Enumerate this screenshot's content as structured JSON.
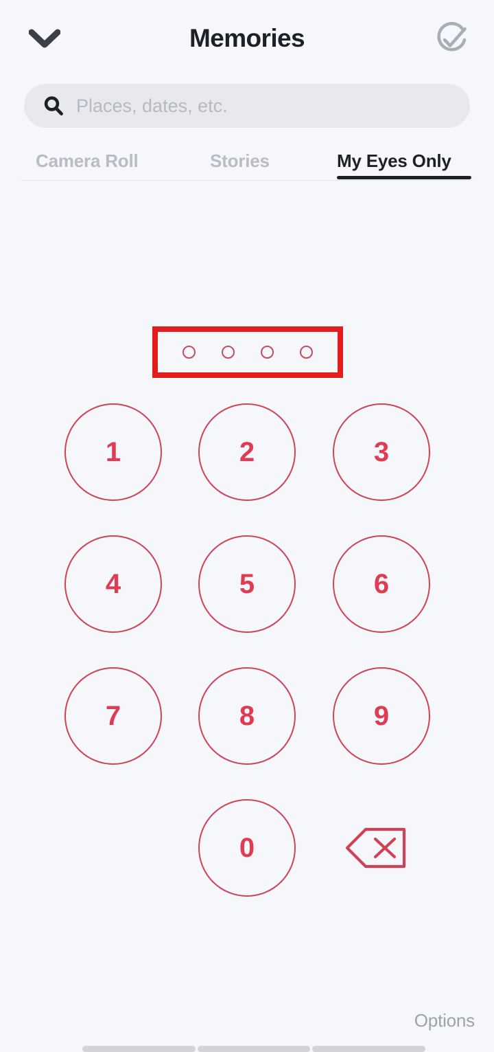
{
  "app": {
    "background_color": "#f6f7fa",
    "accent_color": "#e03b53",
    "annotation_color": "#e11d1d"
  },
  "header": {
    "title": "Memories",
    "back_icon": "chevron-down-icon",
    "confirm_icon": "check-circle-icon"
  },
  "search": {
    "icon": "search-icon",
    "value": "",
    "placeholder": "Places, dates, etc."
  },
  "tabs": {
    "items": [
      {
        "label": "Camera Roll",
        "active": false
      },
      {
        "label": "Stories",
        "active": false
      },
      {
        "label": "My Eyes Only",
        "active": true
      }
    ]
  },
  "passcode": {
    "dot_count": 4,
    "entered_count": 0,
    "dots": [
      "",
      "",
      "",
      ""
    ],
    "annotated": true,
    "annotation_label": "passcode-dots-highlight"
  },
  "keypad": {
    "keys": [
      {
        "label": "1"
      },
      {
        "label": "2"
      },
      {
        "label": "3"
      },
      {
        "label": "4"
      },
      {
        "label": "5"
      },
      {
        "label": "6"
      },
      {
        "label": "7"
      },
      {
        "label": "8"
      },
      {
        "label": "9"
      },
      {
        "label": "0"
      }
    ],
    "backspace_icon": "backspace-delete-icon"
  },
  "footer": {
    "options_label": "Options",
    "home_indicator_segments": 3
  }
}
